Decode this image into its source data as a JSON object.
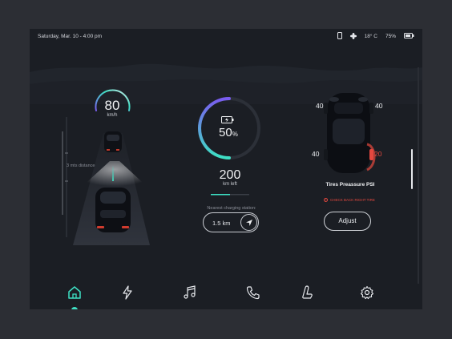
{
  "status_bar": {
    "datetime": "Saturday, Mar. 10 - 4:00 pm",
    "temperature": "18° C",
    "battery": "75%"
  },
  "speed": {
    "value": "80",
    "unit": "km/h"
  },
  "distance_label": "3 mts distance",
  "battery_gauge": {
    "percent": "50",
    "percent_symbol": "%",
    "level": 0.5
  },
  "range": {
    "value": "200",
    "unit": "km left"
  },
  "charging": {
    "label": "Nearest charging station:",
    "distance": "1.5 km"
  },
  "tires": {
    "front_left": "40",
    "front_right": "40",
    "rear_left": "40",
    "rear_right": "20",
    "title": "Tires Preassure PSI",
    "warning": "CHECK BACK RIGHT TIRE",
    "adjust_label": "Adjust"
  },
  "dock": {
    "items": [
      "home-icon",
      "lightning-icon",
      "music-icon",
      "phone-icon",
      "seat-icon",
      "gear-icon"
    ],
    "active": "home-icon"
  },
  "colors": {
    "accent_teal": "#3ee0c4",
    "accent_purple": "#7a5cf0",
    "warning_red": "#e5483f",
    "background": "#1b1e24"
  }
}
